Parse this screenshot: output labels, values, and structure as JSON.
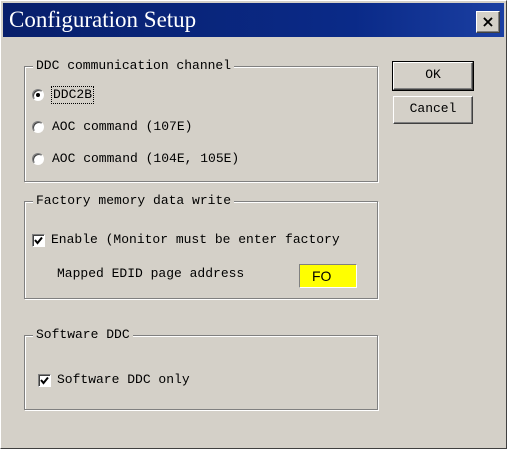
{
  "window": {
    "title": "Configuration Setup",
    "close_glyph": "×"
  },
  "buttons": {
    "ok": "OK",
    "cancel": "Cancel"
  },
  "ddc_group": {
    "legend": "DDC communication channel",
    "options": [
      {
        "label": "DDC2B",
        "selected": true
      },
      {
        "label": "AOC command (107E)",
        "selected": false
      },
      {
        "label": "AOC command (104E, 105E)",
        "selected": false
      }
    ]
  },
  "factory_group": {
    "legend": "Factory memory data write",
    "enable_label": "Enable (Monitor must be enter factory",
    "enable_checked": true,
    "address_label": "Mapped EDID page address",
    "address_value": "FO",
    "address_bg": "#ffff00"
  },
  "software_group": {
    "legend": "Software DDC",
    "checkbox_label": "Software DDC only",
    "checked": true
  }
}
